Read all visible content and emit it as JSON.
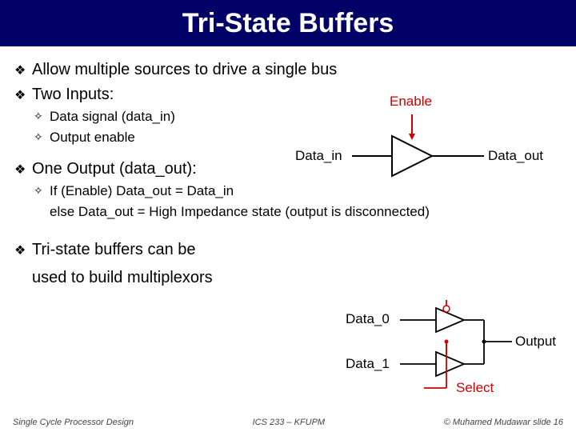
{
  "title": "Tri-State Buffers",
  "b1": "Allow multiple sources to drive a single bus",
  "b2": "Two Inputs:",
  "b2a": "Data signal (data_in)",
  "b2b": "Output enable",
  "b3": "One Output (data_out):",
  "b3a": "If (Enable) Data_out = Data_in",
  "b3b": "else Data_out = High Impedance state (output is disconnected)",
  "b4": "Tri-state buffers can be",
  "b4b": "used to build multiplexors",
  "d1": {
    "enable": "Enable",
    "din": "Data_in",
    "dout": "Data_out"
  },
  "d2": {
    "data0": "Data_0",
    "data1": "Data_1",
    "output": "Output",
    "select": "Select"
  },
  "footer": {
    "left": "Single Cycle Processor Design",
    "center": "ICS 233 – KFUPM",
    "right": "© Muhamed Mudawar   slide 16"
  }
}
